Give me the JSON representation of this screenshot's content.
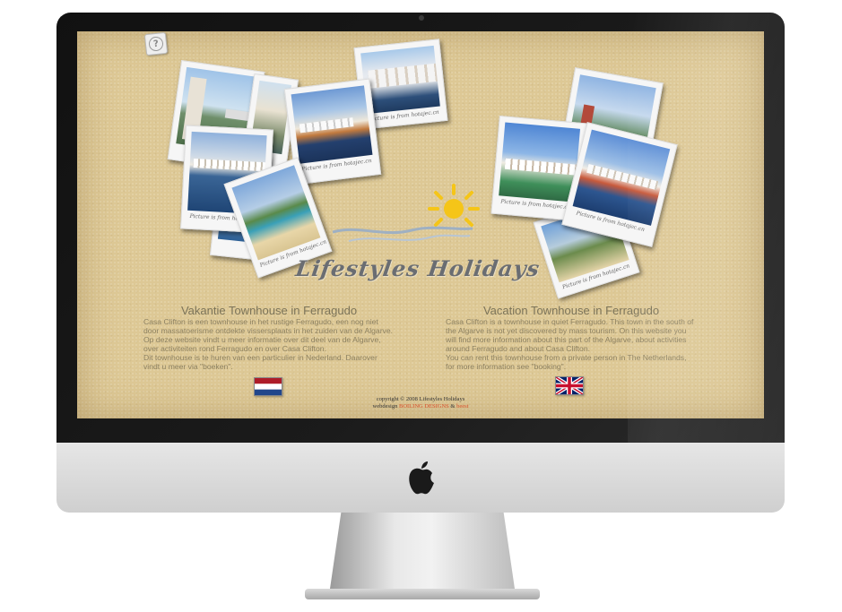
{
  "site": {
    "help_icon": "question-icon",
    "logo_text": "Lifestyles Holidays",
    "photo_caption": "Picture is from hotajec.cn"
  },
  "dutch": {
    "heading": "Vakantie Townhouse in Ferragudo",
    "body": "Casa Clifton is een townhouse in het rustige Ferragudo, een nog niet door massatoerisme ontdekte vissersplaats in het zuiden van de Algarve. Op deze website vindt u meer informatie over dit deel van de Algarve, over activiteiten rond Ferragudo en over Casa Clifton.",
    "body2": "Dit townhouse is te huren van een particulier in Nederland. Daarover vindt u meer via \"boeken\"."
  },
  "english": {
    "heading": "Vacation Townhouse in Ferragudo",
    "body": "Casa Clifton is a townhouse in quiet Ferragudo. This town in the south of the Algarve is not yet discovered by mass tourism. On this website you will find more information about this part of the Algarve, about activities around Ferragudo and about Casa Clifton.",
    "body2": "You can rent this townhouse from a private person in The Netherlands, for more information see \"booking\"."
  },
  "footer": {
    "copyright": "copyright © 2008 Lifestyles Holidays",
    "webdesign_label": "webdesign",
    "designer": "BOILING DESIGNS",
    "amp": "&",
    "partner": "beest"
  },
  "colors": {
    "background": "#ddc895",
    "text": "#8c8060",
    "heading": "#7b7358",
    "link": "#d8502c",
    "logo": "#6a6d72",
    "sun": "#f5c518"
  }
}
